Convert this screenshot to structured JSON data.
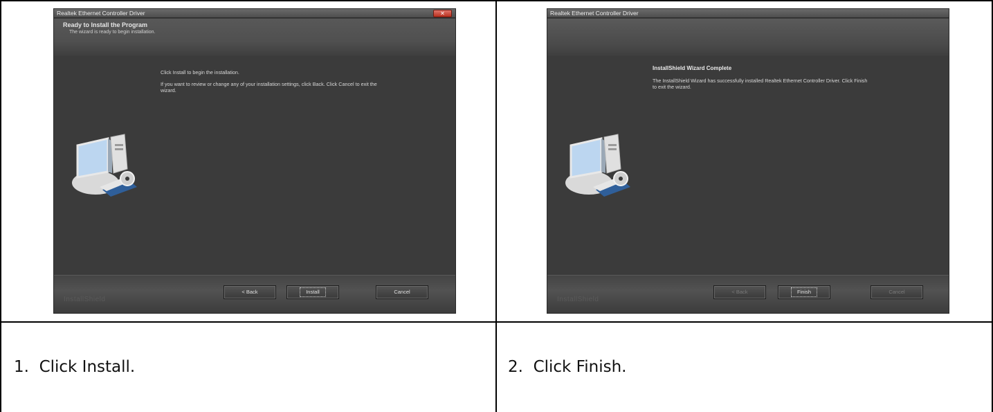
{
  "steps": [
    {
      "caption": "1.  Click Install.",
      "window": {
        "title": "Realtek Ethernet Controller Driver",
        "header_title": "Ready to Install the Program",
        "header_subtitle": "The wizard is ready to begin installation.",
        "body_line1": "Click Install to begin the installation.",
        "body_line2": "If you want to review or change any of your installation settings, click Back. Click Cancel to exit the",
        "body_line3": "wizard.",
        "brand": "InstallShield",
        "buttons": {
          "back": "< Back",
          "primary": "Install",
          "cancel": "Cancel"
        }
      }
    },
    {
      "caption": "2.  Click Finish.",
      "window": {
        "title": "Realtek Ethernet Controller Driver",
        "complete_title": "InstallShield Wizard Complete",
        "body_line1": "The InstallShield Wizard has successfully installed Realtek Ethernet Controller Driver.  Click Finish",
        "body_line2": "to exit the wizard.",
        "brand": "InstallShield",
        "buttons": {
          "back": "< Back",
          "primary": "Finish",
          "cancel": "Cancel"
        }
      }
    }
  ]
}
